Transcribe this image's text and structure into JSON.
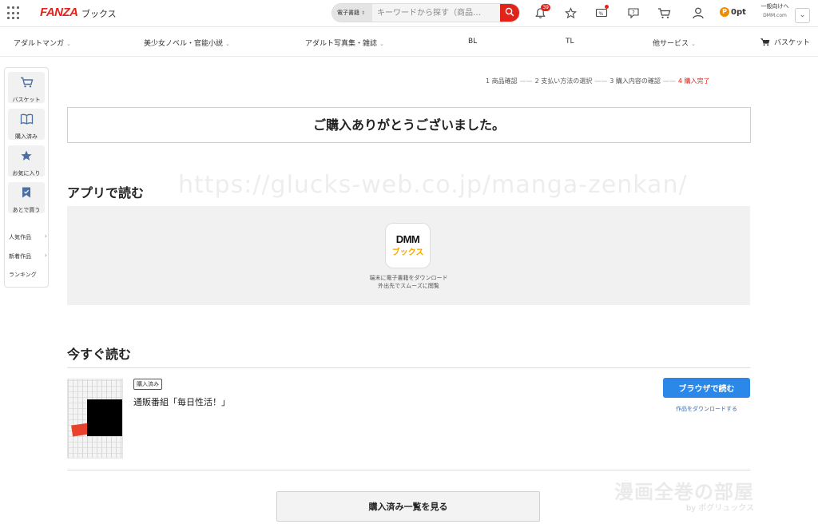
{
  "header": {
    "logo": "FANZA",
    "logo_sub": "ブックス",
    "search_category": "電子書籍",
    "search_placeholder": "キーワードから探す（商品…",
    "notification_count": "39",
    "points": "0pt",
    "general_link": "一般向けへ",
    "general_domain": "DMM.com",
    "icons": [
      "menu-grid-icon",
      "search-icon",
      "bell-icon",
      "star-icon",
      "coupon-icon",
      "help-icon",
      "cart-icon",
      "user-icon",
      "point-coin-icon",
      "chevron-down-icon"
    ],
    "accent_color": "#e2231a"
  },
  "category_nav": {
    "items": [
      "アダルトマンガ",
      "美少女ノベル・官能小説",
      "アダルト写真集・雑誌",
      "BL",
      "TL",
      "他サービス"
    ],
    "basket": "バスケット"
  },
  "sidebar": {
    "buttons": [
      {
        "label": "バスケット",
        "icon": "cart-icon"
      },
      {
        "label": "購入済み",
        "icon": "book-icon"
      },
      {
        "label": "お気に入り",
        "icon": "star-icon"
      },
      {
        "label": "あとで買う",
        "icon": "bookmark-icon"
      }
    ],
    "links": [
      "人気作品",
      "新着作品",
      "ランキング"
    ]
  },
  "steps": {
    "step1": "1 商品確認",
    "step2": "2 支払い方法の選択",
    "step3": "3 購入内容の確認",
    "step4": "4 購入完了",
    "separator": "——"
  },
  "thanks_message": "ご購入ありがとうございました。",
  "watermark": "https://glucks-web.co.jp/manga-zenkan/",
  "app_section": {
    "title": "アプリで読む",
    "app_name_top": "DMM",
    "app_name_bottom": "ブックス",
    "desc_line1": "端末に電子書籍をダウンロード",
    "desc_line2": "外出先でスムーズに閲覧"
  },
  "read_now": {
    "title": "今すぐ読む",
    "badge": "購入済み",
    "item_title": "通販番組「毎日性活！」",
    "browser_button": "ブラウザで読む",
    "download_link": "作品をダウンロードする",
    "primary_color": "#2b87e8"
  },
  "purchased_list_button": "購入済み一覧を見る",
  "brand_mark": {
    "line1": "漫画全巻の部屋",
    "line2": "by ポグリュックス"
  }
}
